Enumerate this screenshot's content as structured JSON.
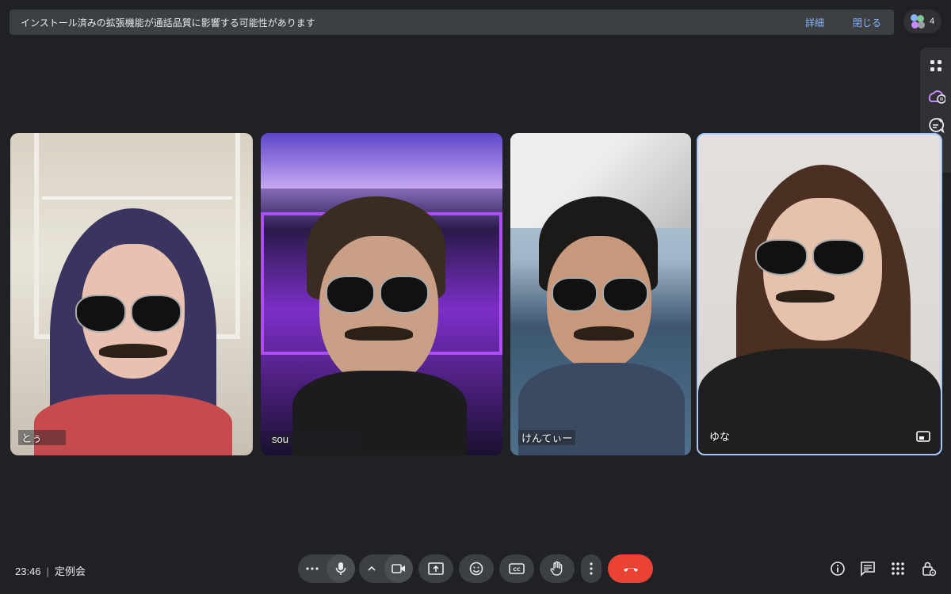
{
  "banner": {
    "message": "インストール済みの拡張機能が通話品質に影響する可能性があります",
    "details_label": "詳細",
    "close_label": "閉じる"
  },
  "participants_count": "4",
  "tiles": [
    {
      "name": "とぅ"
    },
    {
      "name": "sou"
    },
    {
      "name": "けんてぃー"
    },
    {
      "name": "ゆな"
    }
  ],
  "footer": {
    "time": "23:46",
    "meeting_title": "定例会"
  },
  "icons": {
    "apps": "apps-grid-icon",
    "effects": "cloud-effects-icon",
    "chat_ai": "chat-sparkle-icon",
    "whiteboard": "pen-icon",
    "more_horiz": "more-horizontal-icon",
    "mic": "microphone-icon",
    "expand": "chevron-up-icon",
    "camera": "camera-icon",
    "present": "present-screen-icon",
    "emoji": "emoji-icon",
    "captions": "captions-icon",
    "hand": "raise-hand-icon",
    "more_vert": "more-vertical-icon",
    "end_call": "end-call-icon",
    "info": "info-icon",
    "chat": "chat-icon",
    "activities": "activities-icon",
    "lock": "host-controls-lock-icon",
    "pip": "picture-in-picture-icon"
  },
  "colors": {
    "background": "#202124",
    "banner": "#3c4043",
    "link": "#8ab4f8",
    "end_call": "#ea4335",
    "active_tile_border": "#a8c7fa"
  }
}
